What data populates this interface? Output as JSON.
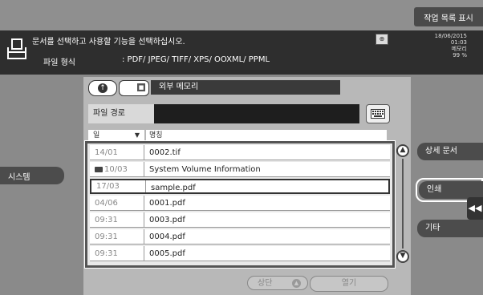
{
  "top": {
    "job_list_label": "작업 목록 표시"
  },
  "header": {
    "message": "문서를 선택하고 사용할 기능을 선택하십시오.",
    "file_type_label": "파일 형식",
    "file_type_value": ": PDF/ JPEG/ TIFF/ XPS/ OOXML/ PPML",
    "datetime": [
      "18/06/2015",
      "01:03",
      "메모리",
      "99 %"
    ]
  },
  "sidebar": {
    "system_label": "시스템"
  },
  "location": {
    "name": "외부 메모리"
  },
  "path": {
    "label": "파일 경로",
    "value": ""
  },
  "columns": {
    "date": "일",
    "name": "명칭"
  },
  "files": [
    {
      "date": "14/01",
      "name": "0002.tif",
      "folder": false
    },
    {
      "date": "10/03",
      "name": "System Volume Information",
      "folder": true
    },
    {
      "date": "17/03",
      "name": "sample.pdf",
      "folder": false,
      "selected": true
    },
    {
      "date": "04/06",
      "name": "0001.pdf",
      "folder": false
    },
    {
      "date": "09:31",
      "name": "0003.pdf",
      "folder": false
    },
    {
      "date": "09:31",
      "name": "0004.pdf",
      "folder": false
    },
    {
      "date": "09:31",
      "name": "0005.pdf",
      "folder": false
    }
  ],
  "bottom": {
    "top_label": "상단",
    "open_label": "열기"
  },
  "right": {
    "detail_label": "상세 문서",
    "print_label": "인쇄",
    "other_label": "기타"
  }
}
